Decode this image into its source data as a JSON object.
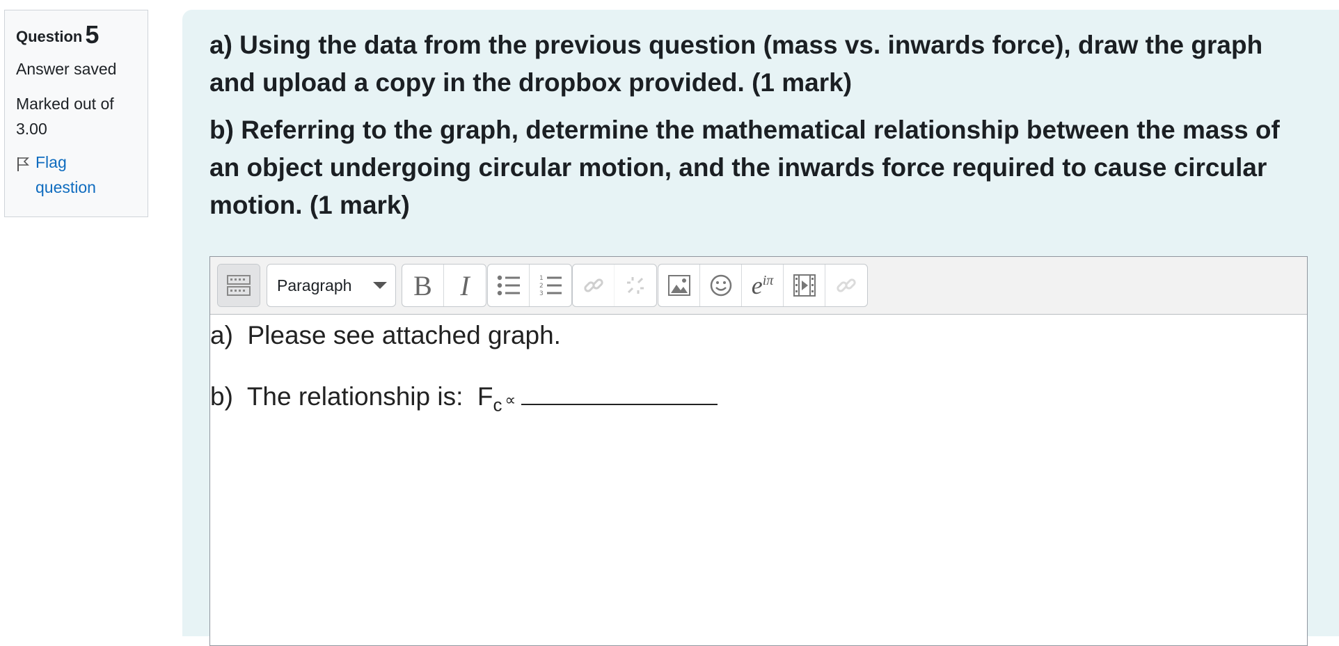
{
  "info": {
    "question_label": "Question",
    "question_number": "5",
    "state": "Answer saved",
    "grade": "Marked out of 3.00",
    "flag_label": "Flag question"
  },
  "question_text": [
    "a) Using the data from the previous question (mass vs. inwards force), draw the graph and upload a copy in the dropbox provided. (1 mark)",
    "b) Referring to the graph, determine the mathematical relationship between the mass of an object undergoing circular motion, and the inwards force required to cause circular motion. (1 mark)"
  ],
  "editor": {
    "paragraph_select": "Paragraph",
    "toolbar_icons": [
      "toolbar-toggle-icon",
      "bold-icon",
      "italic-icon",
      "unordered-list-icon",
      "ordered-list-icon",
      "link-icon",
      "unlink-icon",
      "image-icon",
      "emoji-icon",
      "equation-icon",
      "media-icon",
      "manage-files-icon"
    ],
    "answer": {
      "a_prefix": "a)",
      "a_text": "Please see attached graph.",
      "b_prefix": "b)",
      "b_text": "The relationship is:",
      "force_symbol": "F",
      "force_subscript": "c",
      "proportional": "∝"
    }
  },
  "colors": {
    "panel_bg": "#e7f3f5",
    "link": "#0f6cbf",
    "info_bg": "#f8f9fa"
  }
}
